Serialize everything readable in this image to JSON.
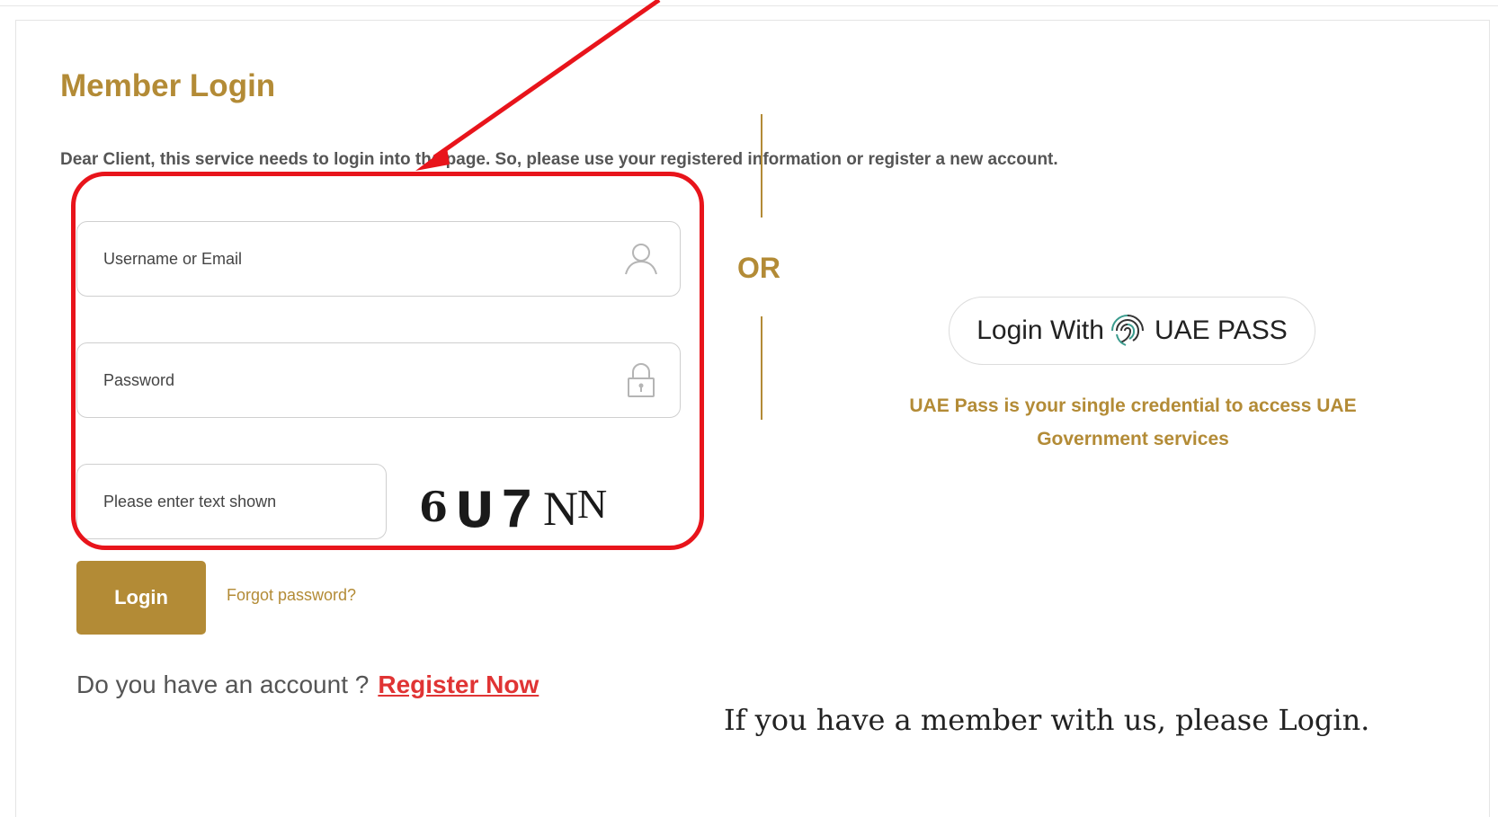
{
  "page": {
    "title": "Member Login",
    "intro": "Dear Client, this service needs to login into the page. So, please use your registered information or register a new account."
  },
  "form": {
    "username_placeholder": "Username or Email",
    "password_placeholder": "Password",
    "captcha_placeholder": "Please enter text shown",
    "captcha_text": "6U7NN",
    "login_label": "Login",
    "forgot_label": "Forgot password?",
    "account_question": "Do you have an account ?",
    "register_label": "Register Now"
  },
  "divider": {
    "or_label": "OR"
  },
  "uae_pass": {
    "button_prefix": "Login With",
    "button_brand": "UAE PASS",
    "description": "UAE Pass is your single credential to access UAE Government services"
  },
  "annotation": {
    "note": "If you have a member with us, please Login.",
    "highlight_color": "#e8141b"
  },
  "colors": {
    "accent": "#b38b36",
    "link_red": "#e03434"
  },
  "icons": {
    "username": "user-icon",
    "password": "lock-icon",
    "uae_pass": "fingerprint-icon"
  }
}
